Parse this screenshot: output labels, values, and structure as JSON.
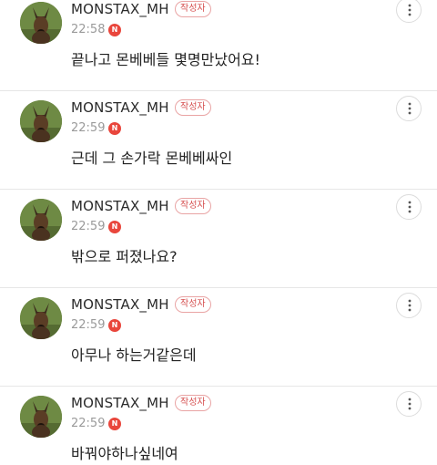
{
  "comments": [
    {
      "author": "MONSTAX_MH",
      "badge": "작성자",
      "time": "22:58",
      "new": "N",
      "text": "끝나고 몬베베들 몇명만났어요!"
    },
    {
      "author": "MONSTAX_MH",
      "badge": "작성자",
      "time": "22:59",
      "new": "N",
      "text": "근데 그 손가락 몬베베싸인"
    },
    {
      "author": "MONSTAX_MH",
      "badge": "작성자",
      "time": "22:59",
      "new": "N",
      "text": "밖으로 퍼졌나요?"
    },
    {
      "author": "MONSTAX_MH",
      "badge": "작성자",
      "time": "22:59",
      "new": "N",
      "text": "아무나 하는거같은데"
    },
    {
      "author": "MONSTAX_MH",
      "badge": "작성자",
      "time": "22:59",
      "new": "N",
      "text": "바꿔야하나싶네여"
    }
  ],
  "icons": {
    "avatar": "dog-profile-avatar",
    "more": "more-options-icon",
    "new_badge": "new-indicator-icon"
  },
  "colors": {
    "badge_text": "#d65050",
    "badge_border": "#e9a4a4",
    "new_dot": "#e9463c",
    "timestamp": "#9a9a9a"
  }
}
